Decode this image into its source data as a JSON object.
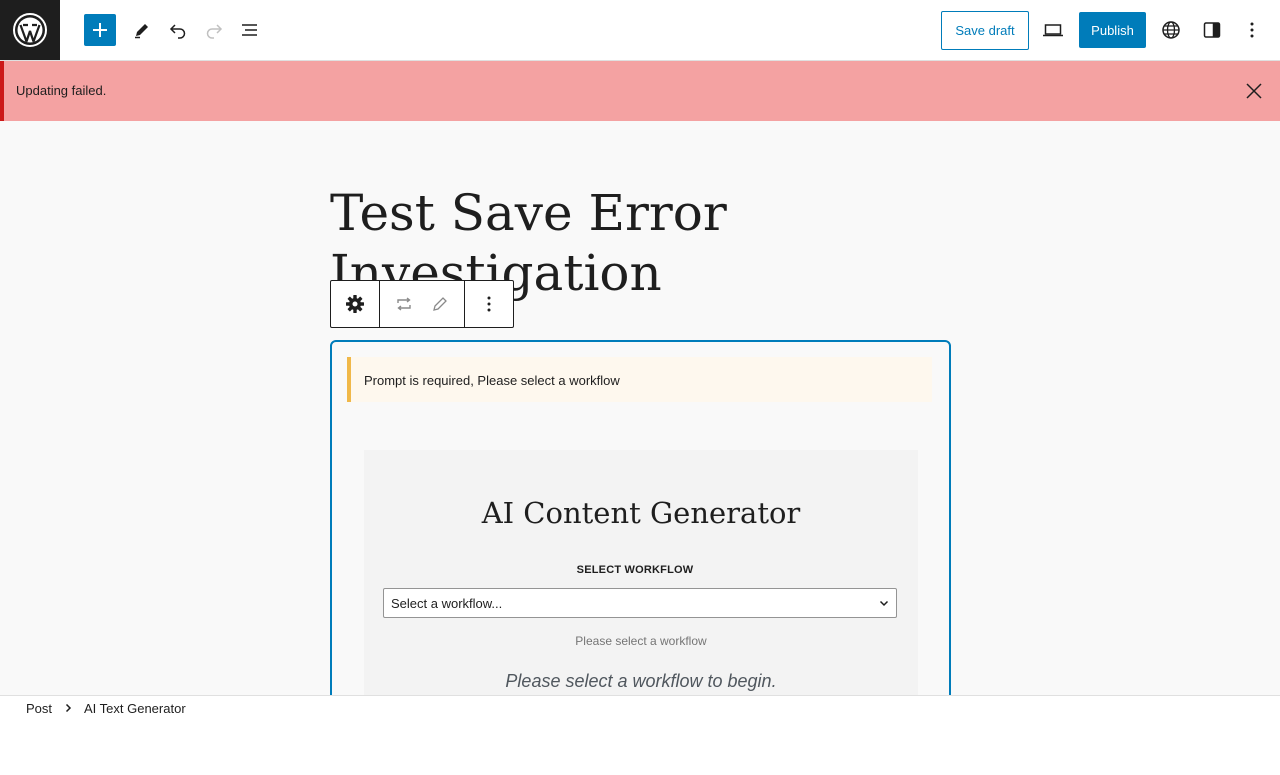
{
  "header": {
    "logo_icon": "wordpress-logo-icon",
    "add_block_icon": "plus-icon",
    "tools_icon": "pencil-icon",
    "undo_icon": "undo-icon",
    "redo_icon": "redo-icon",
    "document_overview_icon": "list-view-icon",
    "save_draft_label": "Save draft",
    "view_icon": "laptop-icon",
    "publish_label": "Publish",
    "language_icon": "globe-icon",
    "settings_icon": "sidebar-icon",
    "options_icon": "more-vertical-icon",
    "accent_color": "#007cba"
  },
  "notice": {
    "text": "Updating failed.",
    "close_icon": "close-icon",
    "background_color": "#f4a2a2",
    "border_color": "#cc1818"
  },
  "editor": {
    "post_title": "Test Save Error Investigation"
  },
  "block_toolbar": {
    "block_type_icon": "gear-icon",
    "transform_icon": "repeat-icon",
    "edit_icon": "pencil-icon",
    "options_icon": "more-vertical-icon"
  },
  "block": {
    "warning_text": "Prompt is required, Please select a workflow",
    "title": "AI Content Generator",
    "workflow_label": "SELECT WORKFLOW",
    "workflow_selected": "Select a workflow...",
    "workflow_help": "Please select a workflow",
    "begin_text": "Please select a workflow to begin."
  },
  "footer": {
    "breadcrumb": [
      "Post",
      "AI Text Generator"
    ]
  }
}
